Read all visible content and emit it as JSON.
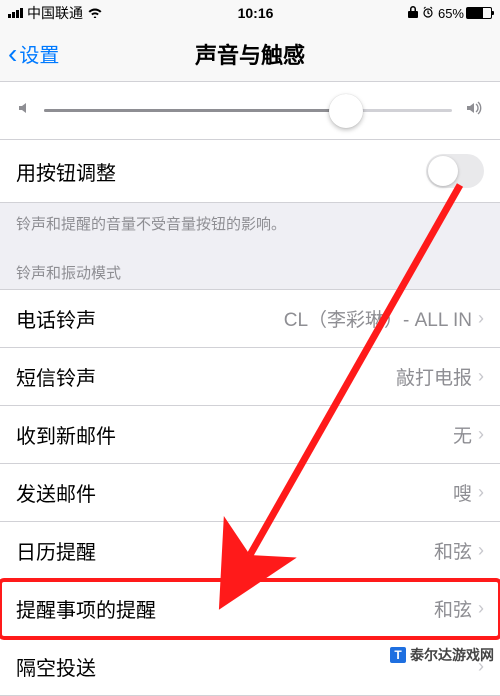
{
  "status": {
    "carrier": "中国联通",
    "time": "10:16",
    "battery_pct": "65%"
  },
  "nav": {
    "back_label": "设置",
    "title": "声音与触感"
  },
  "slider": {
    "percent": 74
  },
  "toggle_row": {
    "label": "用按钮调整"
  },
  "footer_note": "铃声和提醒的音量不受音量按钮的影响。",
  "section_header": "铃声和振动模式",
  "rows": [
    {
      "label": "电话铃声",
      "value": "CL（李彩琳）- ALL IN"
    },
    {
      "label": "短信铃声",
      "value": "敲打电报"
    },
    {
      "label": "收到新邮件",
      "value": "无"
    },
    {
      "label": "发送邮件",
      "value": "嗖"
    },
    {
      "label": "日历提醒",
      "value": "和弦"
    },
    {
      "label": "提醒事项的提醒",
      "value": "和弦"
    },
    {
      "label": "隔空投送",
      "value": ""
    }
  ],
  "watermark": "泰尔达游戏网",
  "watermark_logo": "T"
}
